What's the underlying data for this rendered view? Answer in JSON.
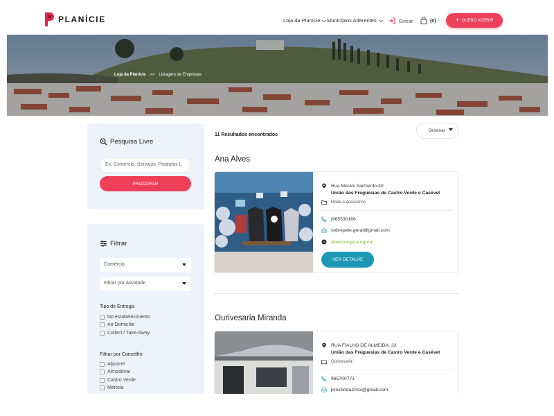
{
  "brand": {
    "name": "PLANÍCIE",
    "accent": "#ee4059",
    "teal": "#1d97b6"
  },
  "nav": {
    "links": [
      {
        "label": "Loja da Planície",
        "icon": "chevron-down-icon"
      },
      {
        "label": "Municípios Aderentes",
        "icon": "chevron-down-icon"
      }
    ],
    "signin": {
      "label": "Entrar",
      "icon": "sign-in-icon"
    },
    "cart": {
      "label": "(0)",
      "icon": "shopping-bag-icon"
    },
    "cta": {
      "label": "QUERO ADERIR",
      "icon": "plus-icon"
    }
  },
  "breadcrumb": {
    "home": "Loja da Planície",
    "separator": ">>",
    "current": "Listagem de Empresas"
  },
  "sidebar": {
    "search": {
      "title": "Pesquisa Livre",
      "icon": "search-icon",
      "placeholder": "Ex: Comércio, Serviços, Produtos L",
      "button": "PROCURAR"
    },
    "filter": {
      "title": "Filtrar",
      "icon": "filter-icon",
      "selects": [
        {
          "value": "Comércio"
        },
        {
          "value": "Filtrar por Atividade"
        }
      ],
      "delivery": {
        "title": "Tipo de Entrega",
        "options": [
          "No estabelecimento",
          "Ao Domicílio",
          "Collect / Take-Away"
        ]
      },
      "county": {
        "title": "Filtrar por Concelho",
        "options": [
          "Aljustrel",
          "Almodôvar",
          "Castro Verde",
          "Mértola"
        ]
      }
    }
  },
  "results": {
    "count_text": "11 Resultados encontrados",
    "sort_label": "Ordenar",
    "items": [
      {
        "name": "Ana Alves",
        "address": "Rua Morais Sarmento 40",
        "parish": "União das Freguesias de Castro Verde e Casével",
        "category": "Moda e acessórios",
        "phone": "|965530166",
        "email": "sobrepele.geral@gmail.com",
        "status": "Aberto Agora Agora!",
        "button": "VER DETALHE"
      },
      {
        "name": "Ourivesaria Miranda",
        "address": "RUA FIALHO DE ALMEIDA, 33",
        "parish": "União das Freguesias de Castro Verde e Casével",
        "category": "Ourivesaria",
        "phone": "965700771",
        "email": "jcmiranda2013@gmail.com"
      }
    ]
  }
}
